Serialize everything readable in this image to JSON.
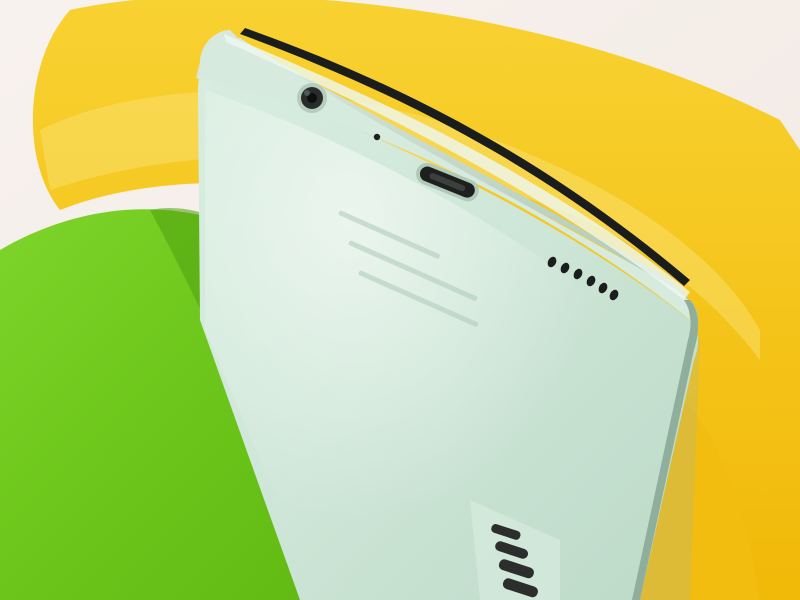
{
  "scene": {
    "subject": "phone-bottom-edge",
    "colors": {
      "background": "#f3eee9",
      "yellow_prop": "#f5c51c",
      "green_prop": "#6cc51a",
      "phone_body": "#cfe7d8",
      "phone_frame": "#b7d2c2",
      "phone_screen_edge": "#1a1d1c",
      "port_dark": "#222322"
    },
    "elements": {
      "headphone_jack": "headphone-jack",
      "microphone": "microphone-hole",
      "usb_port": "usb-c-port",
      "speaker_grille": "speaker-grille",
      "reflection": "speaker-reflection"
    }
  }
}
